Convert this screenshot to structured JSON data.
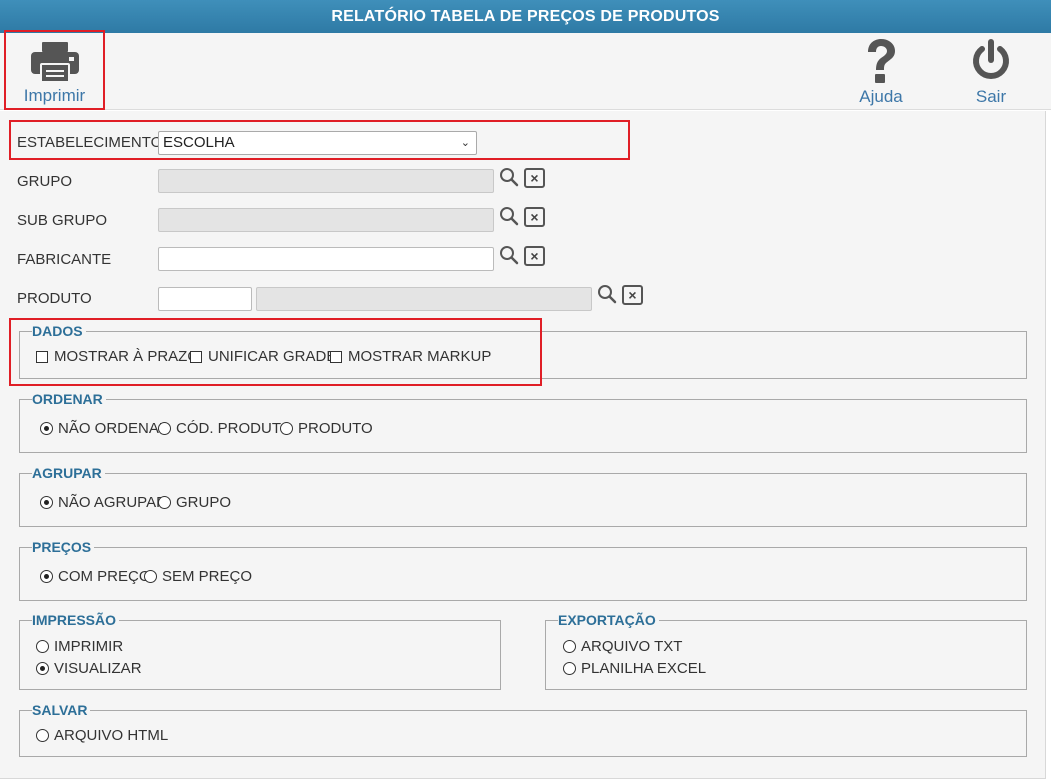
{
  "window": {
    "title": "RELATÓRIO TABELA DE PREÇOS DE PRODUTOS"
  },
  "toolbar": {
    "print_label": "Imprimir",
    "help_label": "Ajuda",
    "exit_label": "Sair",
    "icons": {
      "print": "printer-icon",
      "help": "question-icon",
      "exit": "power-icon"
    }
  },
  "form": {
    "estabelecimento": {
      "label": "ESTABELECIMENTO",
      "value": "ESCOLHA"
    },
    "grupo": {
      "label": "GRUPO",
      "value": ""
    },
    "subgrupo": {
      "label": "SUB GRUPO",
      "value": ""
    },
    "fabricante": {
      "label": "FABRICANTE",
      "value": ""
    },
    "produto": {
      "label": "PRODUTO",
      "code": "",
      "desc": ""
    }
  },
  "dados": {
    "legend": "DADOS",
    "options": [
      {
        "label": "MOSTRAR À PRAZO",
        "checked": false
      },
      {
        "label": "UNIFICAR GRADE",
        "checked": false
      },
      {
        "label": "MOSTRAR MARKUP",
        "checked": false
      }
    ]
  },
  "ordenar": {
    "legend": "ORDENAR",
    "options": [
      {
        "label": "NÃO ORDENAR",
        "selected": true
      },
      {
        "label": "CÓD. PRODUTO",
        "selected": false
      },
      {
        "label": "PRODUTO",
        "selected": false
      }
    ]
  },
  "agrupar": {
    "legend": "AGRUPAR",
    "options": [
      {
        "label": "NÃO AGRUPAR",
        "selected": true
      },
      {
        "label": "GRUPO",
        "selected": false
      }
    ]
  },
  "precos": {
    "legend": "PREÇOS",
    "options": [
      {
        "label": "COM PREÇO",
        "selected": true
      },
      {
        "label": "SEM PREÇO",
        "selected": false
      }
    ]
  },
  "impressao": {
    "legend": "IMPRESSÃO",
    "options": [
      {
        "label": "IMPRIMIR",
        "selected": false
      },
      {
        "label": "VISUALIZAR",
        "selected": true
      }
    ]
  },
  "exportacao": {
    "legend": "EXPORTAÇÃO",
    "options": [
      {
        "label": "ARQUIVO TXT",
        "selected": false
      },
      {
        "label": "PLANILHA EXCEL",
        "selected": false
      }
    ]
  },
  "salvar": {
    "legend": "SALVAR",
    "options": [
      {
        "label": "ARQUIVO HTML",
        "selected": false
      }
    ]
  },
  "colors": {
    "titlebar": "#3586b1",
    "accent": "#2d6f98",
    "highlight": "#e01e26"
  }
}
